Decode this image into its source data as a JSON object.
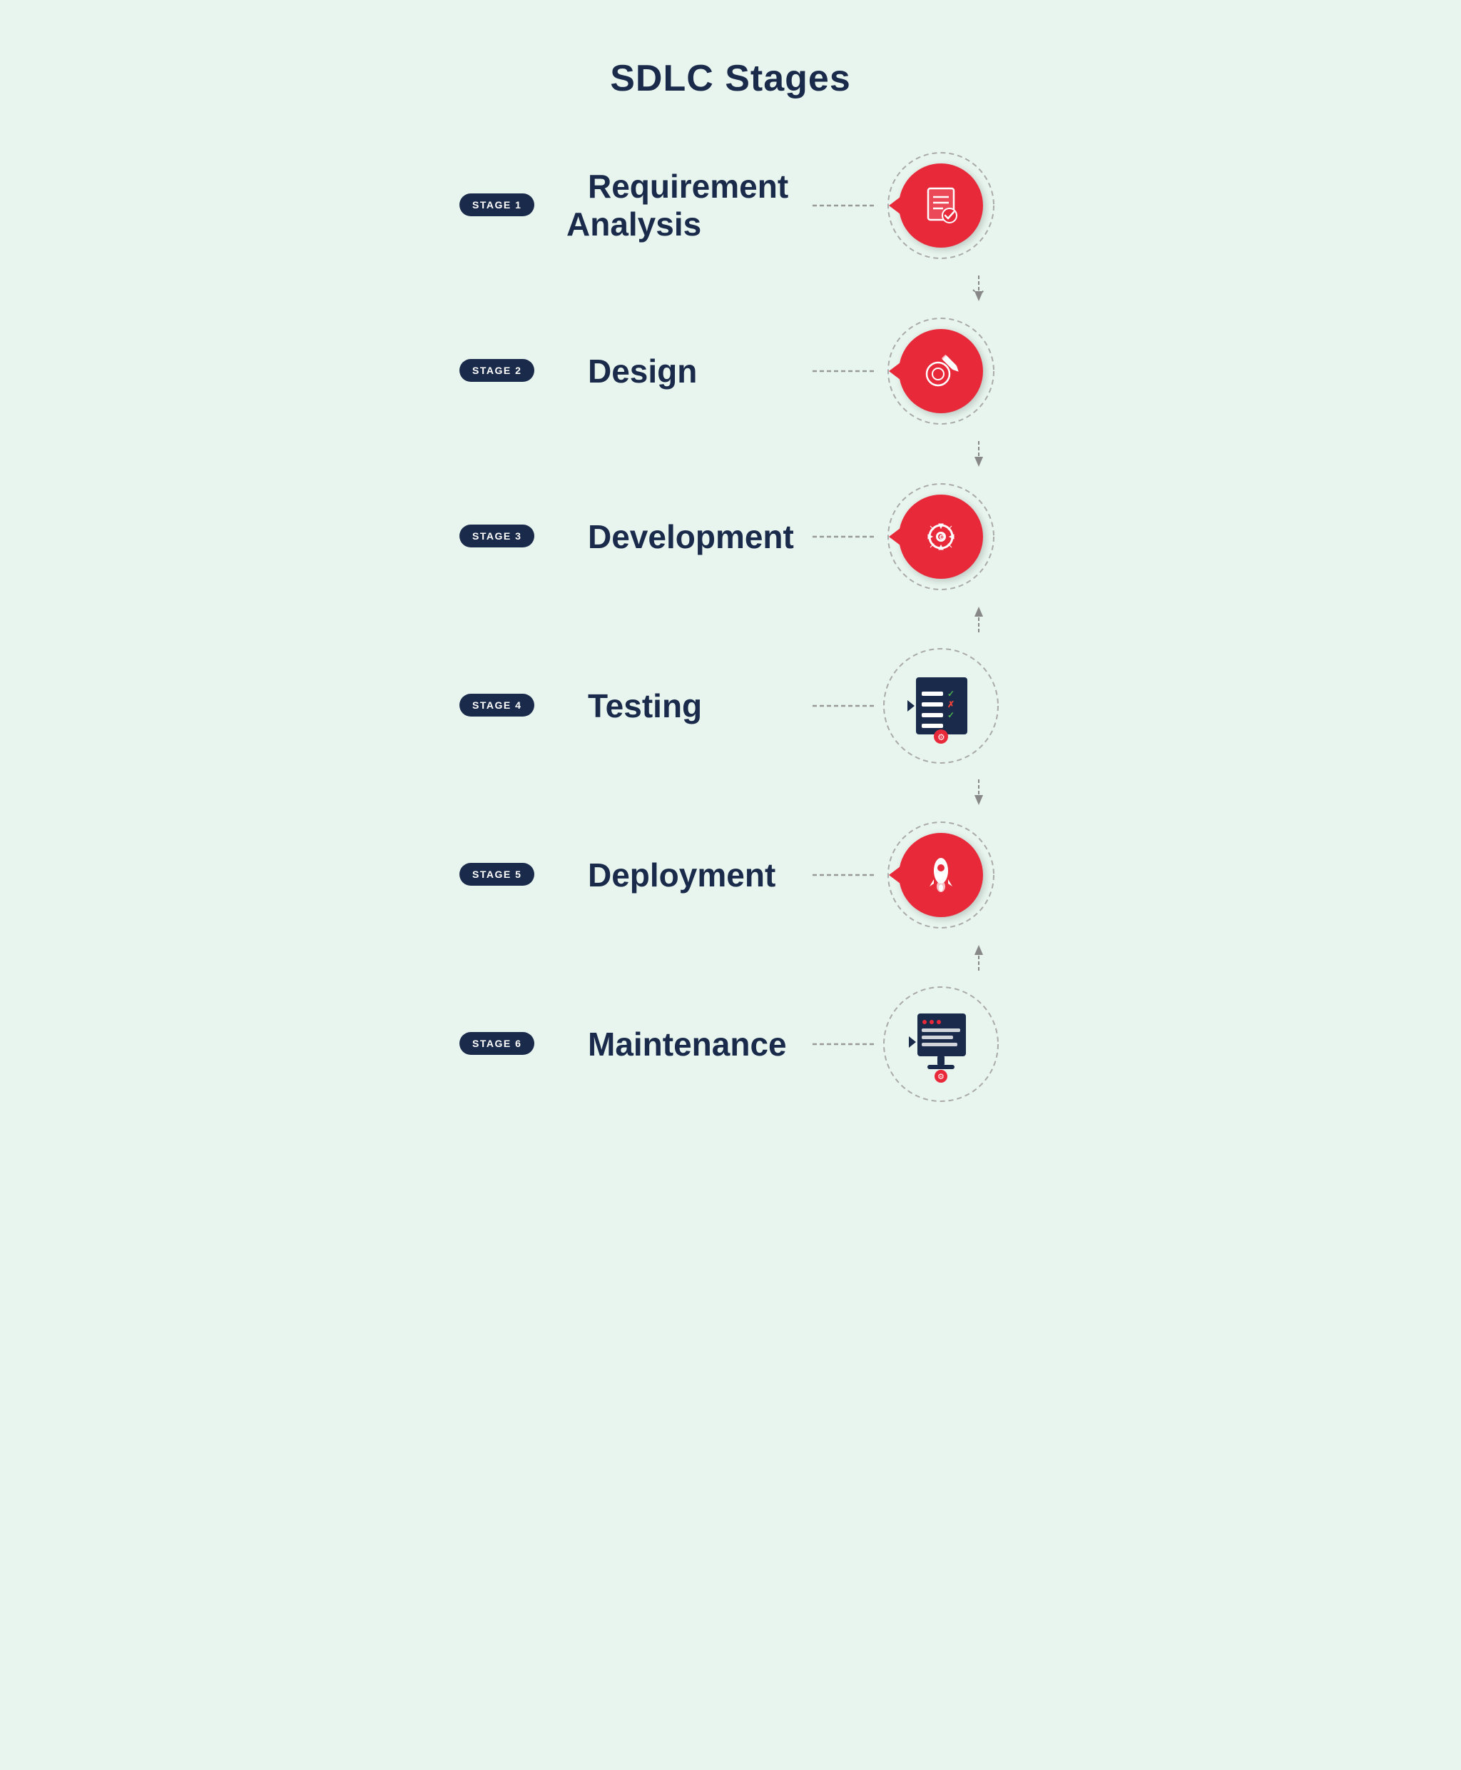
{
  "title": "SDLC Stages",
  "stages": [
    {
      "id": 1,
      "badge": "STAGE 1",
      "label": "Requirement Analysis",
      "icon_type": "requirement",
      "arrow_dir": "right"
    },
    {
      "id": 2,
      "badge": "STAGE 2",
      "label": "Design",
      "icon_type": "design",
      "arrow_dir": "right"
    },
    {
      "id": 3,
      "badge": "STAGE 3",
      "label": "Development",
      "icon_type": "development",
      "arrow_dir": "right"
    },
    {
      "id": 4,
      "badge": "STAGE 4",
      "label": "Testing",
      "icon_type": "testing",
      "arrow_dir": "right"
    },
    {
      "id": 5,
      "badge": "STAGE 5",
      "label": "Deployment",
      "icon_type": "deployment",
      "arrow_dir": "right"
    },
    {
      "id": 6,
      "badge": "STAGE 6",
      "label": "Maintenance",
      "icon_type": "maintenance",
      "arrow_dir": "right"
    }
  ],
  "colors": {
    "background": "#e8f5ee",
    "badge_bg": "#1a2a4a",
    "badge_text": "#ffffff",
    "title": "#1a2a4a",
    "label": "#1a2a4a",
    "icon_red": "#e8293a",
    "dashed": "#999999"
  }
}
